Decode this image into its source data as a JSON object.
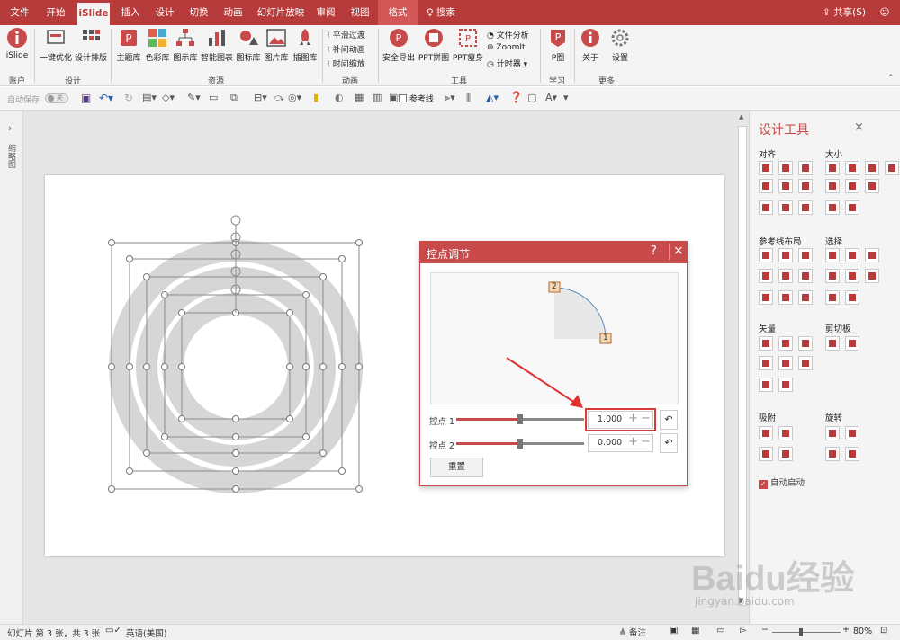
{
  "tabs": [
    "文件",
    "开始",
    "iSlide",
    "插入",
    "设计",
    "切换",
    "动画",
    "幻灯片放映",
    "审阅",
    "视图",
    "格式"
  ],
  "search_label": "搜索",
  "share_label": "共享(S)",
  "ribbon": {
    "big_buttons": [
      "iSlide",
      "一键优化",
      "设计排版",
      "主题库",
      "色彩库",
      "图示库",
      "智能图表",
      "图标库",
      "图片库",
      "插图库",
      "安全导出",
      "PPT拼图",
      "PPT瘦身",
      "P圈",
      "关于",
      "设置"
    ],
    "animation_items": [
      "平滑过渡",
      "补间动画",
      "时间缩放"
    ],
    "tool_items": [
      "文件分析",
      "ZoomIt",
      "计时器"
    ],
    "groups": [
      "账户",
      "设计",
      "资源",
      "动画",
      "工具",
      "学习",
      "更多"
    ]
  },
  "qat": {
    "autosave_label": "自动保存",
    "autosave_state": "关",
    "guides_label": "参考线"
  },
  "left_panel_label": "缩略图",
  "dialog": {
    "title": "控点调节",
    "help": "?",
    "close": "×",
    "preview_points": [
      "2",
      "1"
    ],
    "handle1_label": "控点 1",
    "handle1_value": "1.000",
    "handle2_label": "控点 2",
    "handle2_value": "0.000",
    "reset_label": "重置"
  },
  "panel": {
    "title": "设计工具",
    "close": "×",
    "sections": [
      "对齐",
      "大小",
      "参考线布局",
      "选择",
      "矢量",
      "剪切板",
      "吸附",
      "旋转"
    ],
    "autostart_label": "自动启动",
    "autostart_checked": true
  },
  "status": {
    "slide_info": "幻灯片 第 3 张，共 3 张",
    "language": "英语(美国)",
    "notes": "备注",
    "zoom": "80%"
  },
  "watermark": {
    "brand": "Baidu经验",
    "url": "jingyan.baidu.com"
  },
  "colors": {
    "accent": "#b83b3b",
    "ring": "#d6d6d6",
    "highlight": "#e03030"
  }
}
